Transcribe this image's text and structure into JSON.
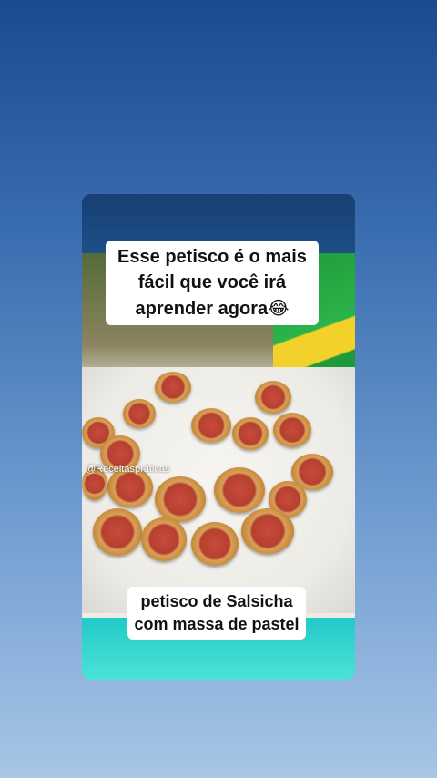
{
  "post": {
    "caption_top_lines": [
      "Esse petisco é o mais",
      "fácil que você irá",
      "aprender agora"
    ],
    "caption_top_emoji": "😂",
    "caption_bottom_lines": [
      "petisco de Salsicha",
      "com massa de pastel"
    ],
    "watermark": "@Receitaspráticas"
  },
  "colors": {
    "background_top": "#1b4a8f",
    "background_bottom": "#a7c6e6",
    "card_bottom_accent": "#45e0d6",
    "caption_box": "#ffffff"
  }
}
